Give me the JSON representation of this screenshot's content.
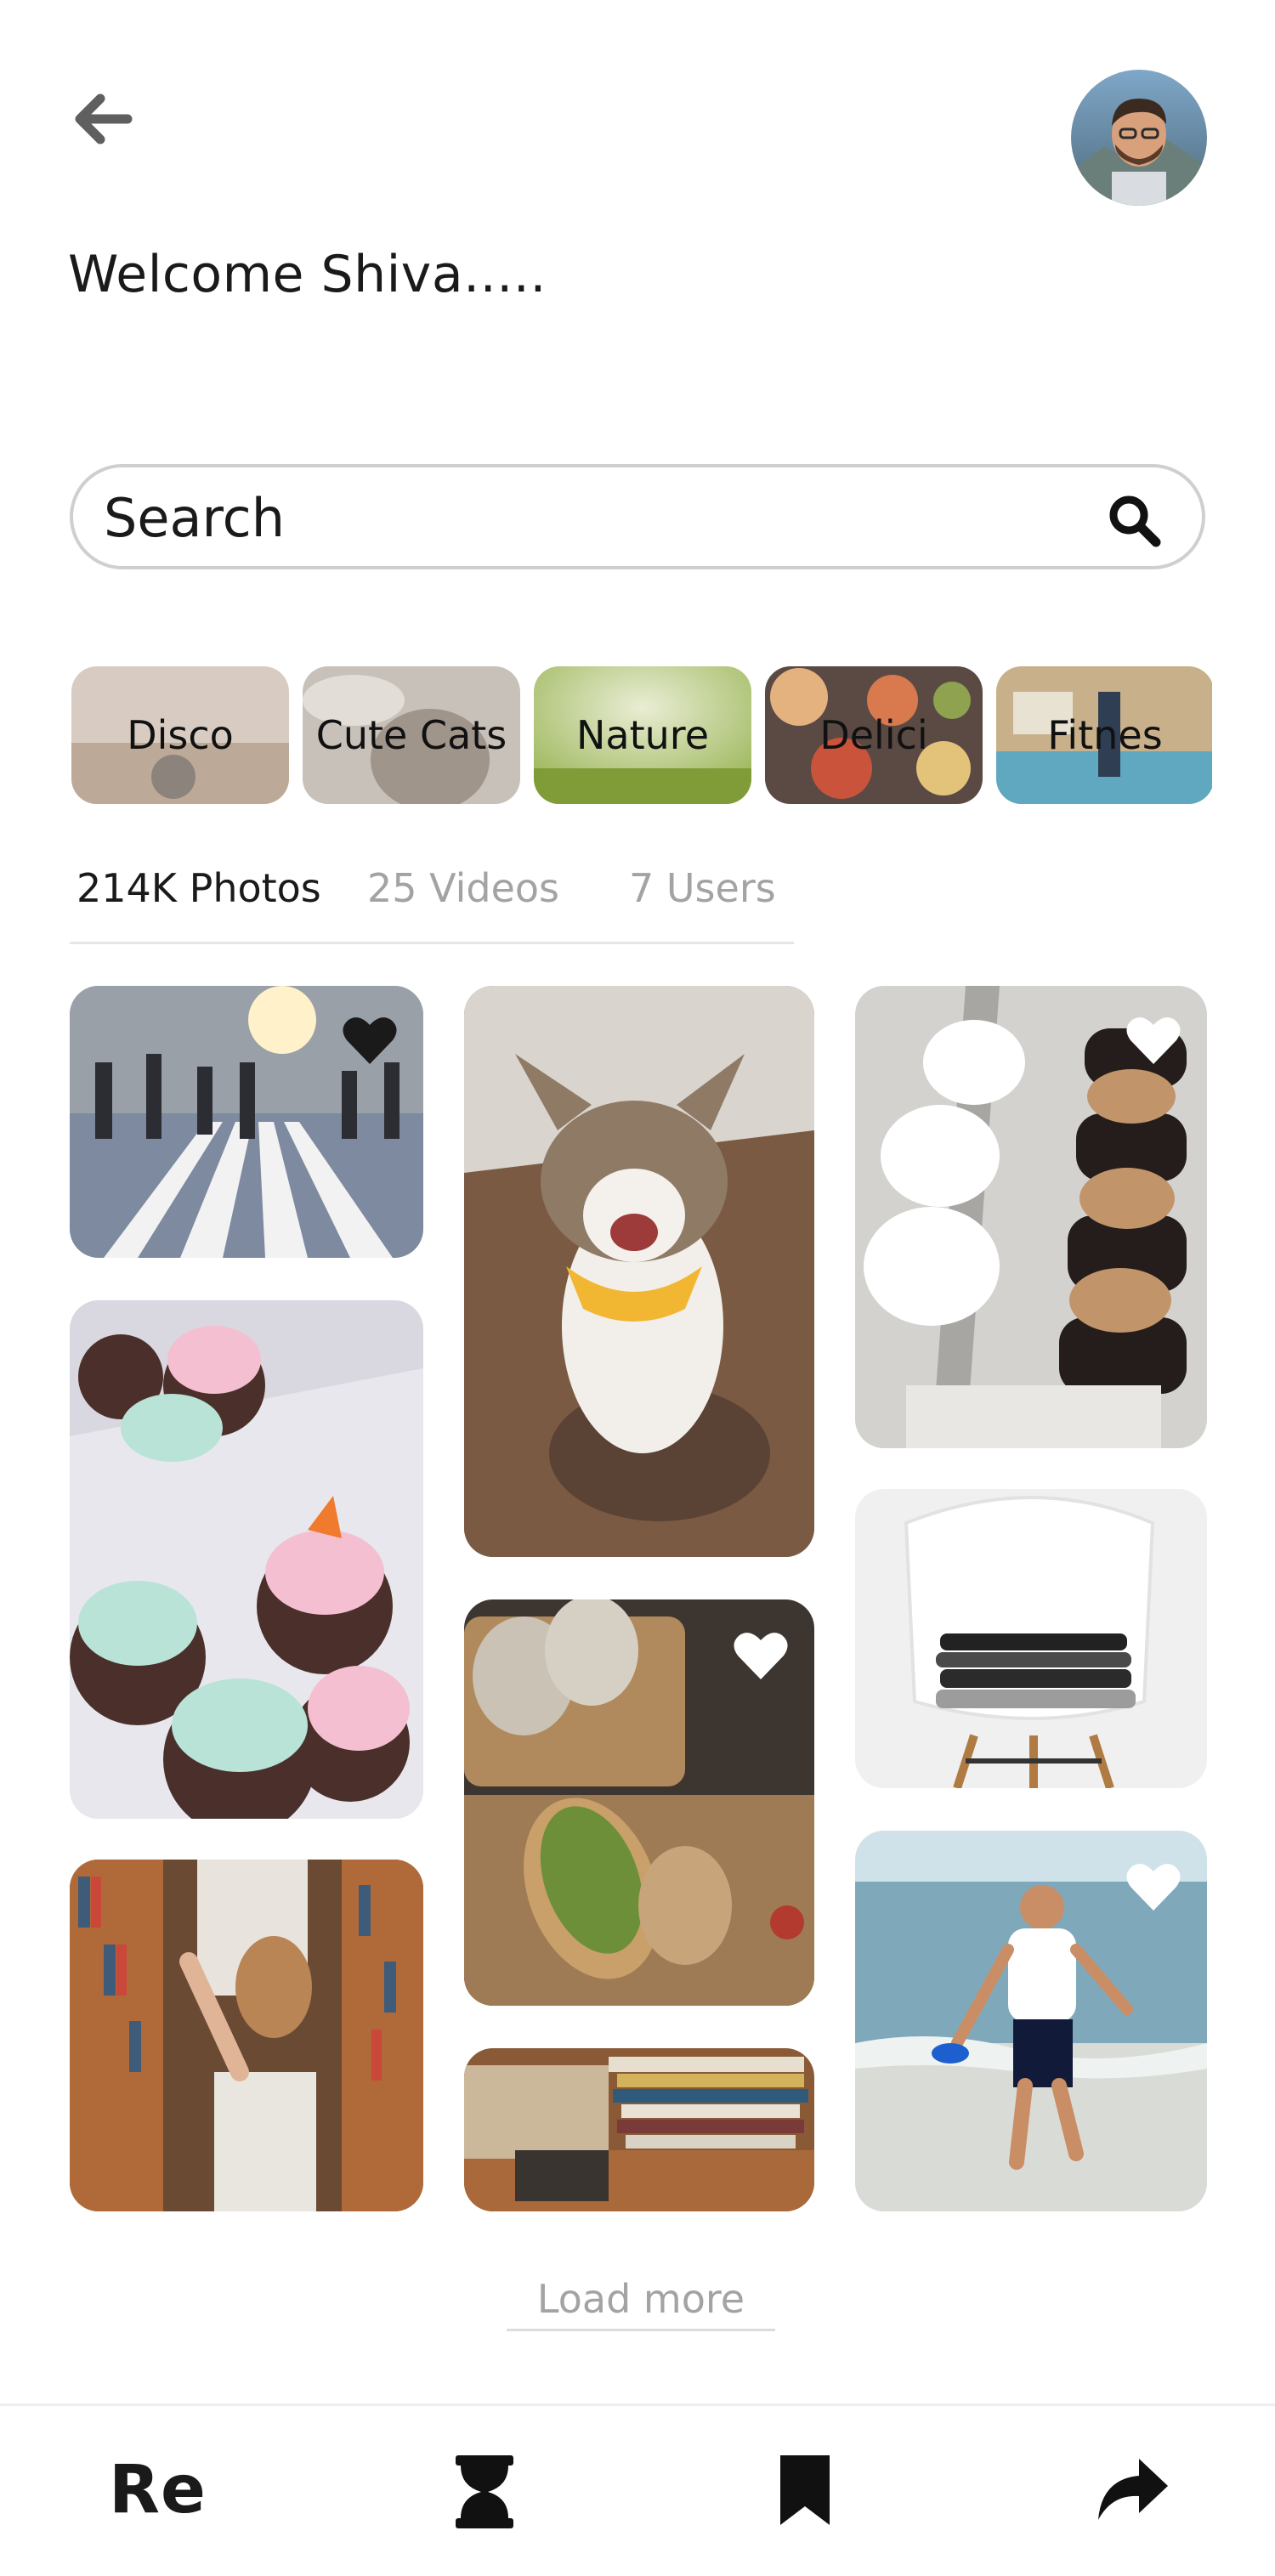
{
  "header": {
    "back_icon": "arrow-left-icon",
    "avatar": "user-avatar",
    "welcome": "Welcome Shiva....."
  },
  "search": {
    "placeholder": "Search",
    "icon": "search-icon"
  },
  "categories": [
    {
      "label": "Disco",
      "color": "#c9b7a8"
    },
    {
      "label": "Cute Cats",
      "color": "#b9b0a7"
    },
    {
      "label": "Nature",
      "color": "#b7c97a"
    },
    {
      "label": "Delici",
      "color": "#a85d3b"
    },
    {
      "label": "Fitnes",
      "color": "#9fb7b7"
    }
  ],
  "tabs": [
    {
      "label": "214K Photos",
      "active": true
    },
    {
      "label": "25 Videos",
      "active": false
    },
    {
      "label": "7 Users",
      "active": false
    }
  ],
  "photos": [
    {
      "name": "crosswalk",
      "liked": true
    },
    {
      "name": "cupcakes",
      "liked": false
    },
    {
      "name": "library",
      "liked": false
    },
    {
      "name": "cat",
      "liked": false
    },
    {
      "name": "avocado-toast",
      "liked": true
    },
    {
      "name": "books",
      "liked": false
    },
    {
      "name": "desserts",
      "liked": true
    },
    {
      "name": "chair",
      "liked": false
    },
    {
      "name": "beach-boy",
      "liked": true
    }
  ],
  "load_more": "Load more",
  "nav": {
    "brand": "Re",
    "icons": [
      "hourglass-icon",
      "bookmark-icon",
      "share-icon"
    ]
  },
  "colors": {
    "text": "#1a1a1a",
    "muted": "#a3a3a3",
    "border": "#cfcfcf",
    "icon": "#5f5f5f"
  }
}
